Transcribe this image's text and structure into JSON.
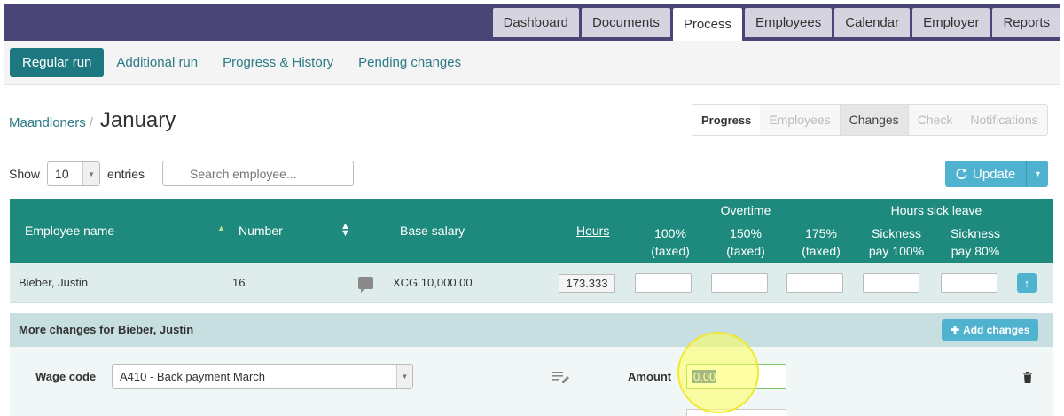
{
  "topnav": {
    "tabs": [
      "Dashboard",
      "Documents",
      "Process",
      "Employees",
      "Calendar",
      "Employer",
      "Reports"
    ],
    "active": "Process"
  },
  "subnav": {
    "items": [
      "Regular run",
      "Additional run",
      "Progress & History",
      "Pending changes"
    ],
    "active": "Regular run"
  },
  "breadcrumb": {
    "parent": "Maandloners",
    "separator": "/",
    "title": "January"
  },
  "steps": [
    "Progress",
    "Employees",
    "Changes",
    "Check",
    "Notifications"
  ],
  "entries": {
    "show_label": "Show",
    "value": "10",
    "suffix": "entries"
  },
  "search": {
    "placeholder": "Search employee..."
  },
  "update": {
    "label": "Update"
  },
  "table": {
    "headers": {
      "employee_name": "Employee name",
      "number": "Number",
      "base_salary": "Base salary",
      "hours": "Hours",
      "overtime_group": "Overtime",
      "ot100": "100%\n(taxed)",
      "ot150": "150%\n(taxed)",
      "ot175": "175%\n(taxed)",
      "sick_group": "Hours sick leave",
      "sick100": "Sickness\npay 100%",
      "sick80": "Sickness\npay 80%"
    },
    "row": {
      "name": "Bieber, Justin",
      "number": "16",
      "base_salary": "XCG 10,000.00",
      "hours": "173.333"
    }
  },
  "more_changes": {
    "label": "More changes for Bieber, Justin",
    "add_button": "Add changes",
    "wage_code_label": "Wage code",
    "wage_code_value": "A410 - Back payment March",
    "amount_label": "Amount",
    "amount_value": "0.00"
  },
  "colors": {
    "topbar": "#4a4577",
    "accent": "#1d7882",
    "table_header": "#1e8a7e",
    "button": "#4fb3cf"
  }
}
